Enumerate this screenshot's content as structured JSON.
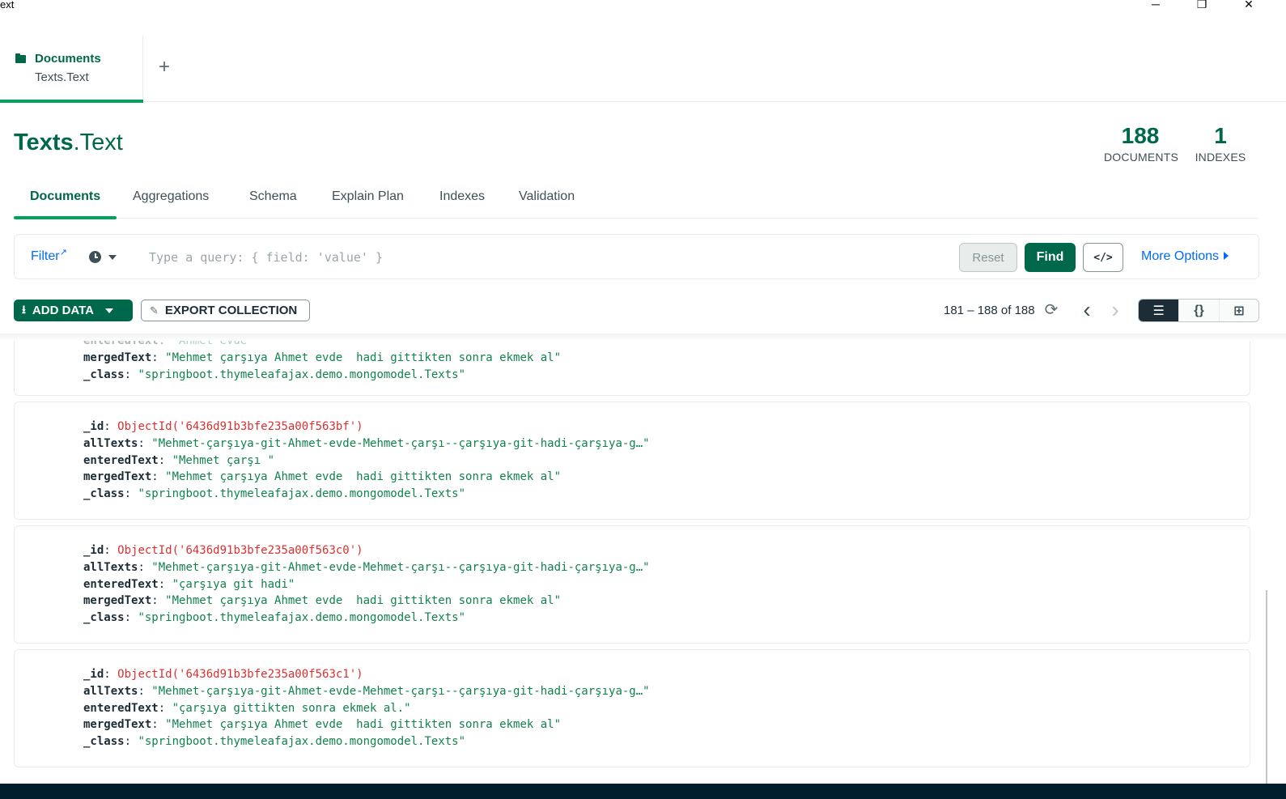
{
  "window": {
    "title": "ext",
    "minimize_glyph": "─",
    "restore_glyph": "❐",
    "close_glyph": "✕"
  },
  "workspace_tab": {
    "title": "Documents",
    "subtitle": "Texts.Text",
    "add_glyph": "+"
  },
  "collection": {
    "db": "Texts",
    "coll": ".Text"
  },
  "stats": [
    {
      "value": "188",
      "label": "DOCUMENTS"
    },
    {
      "value": "1",
      "label": "INDEXES"
    }
  ],
  "tabs": [
    {
      "label": "Documents",
      "active": true
    },
    {
      "label": "Aggregations"
    },
    {
      "label": "Schema"
    },
    {
      "label": "Explain Plan"
    },
    {
      "label": "Indexes"
    },
    {
      "label": "Validation"
    }
  ],
  "query_bar": {
    "filter_label": "Filter",
    "placeholder": "Type a query: { field: 'value' }",
    "reset_label": "Reset",
    "find_label": "Find",
    "code_glyph": "</>",
    "more_options_label": "More Options"
  },
  "toolbar": {
    "add_data_label": "ADD DATA",
    "export_label": "EXPORT COLLECTION",
    "pagination": "181 – 188 of 188",
    "refresh_glyph": "⟳",
    "prev_glyph": "‹",
    "next_glyph": "›",
    "view_list_glyph": "☰",
    "view_json_glyph": "{}",
    "view_table_glyph": "⊞"
  },
  "documents": [
    {
      "partial": true,
      "fields": [
        {
          "key": "enteredText",
          "type": "string",
          "value": "\"Ahmet evde\""
        },
        {
          "key": "mergedText",
          "type": "string",
          "value": "\"Mehmet çarşıya Ahmet evde  hadi gittikten sonra ekmek al\""
        },
        {
          "key": "_class",
          "type": "string",
          "value": "\"springboot.thymeleafajax.demo.mongomodel.Texts\""
        }
      ]
    },
    {
      "fields": [
        {
          "key": "_id",
          "type": "oid",
          "value": "ObjectId('6436d91b3bfe235a00f563bf')"
        },
        {
          "key": "allTexts",
          "type": "string",
          "value": "\"Mehmet-çarşıya-git-Ahmet-evde-Mehmet-çarşı--çarşıya-git-hadi-çarşıya-g…\""
        },
        {
          "key": "enteredText",
          "type": "string",
          "value": "\"Mehmet çarşı \""
        },
        {
          "key": "mergedText",
          "type": "string",
          "value": "\"Mehmet çarşıya Ahmet evde  hadi gittikten sonra ekmek al\""
        },
        {
          "key": "_class",
          "type": "string",
          "value": "\"springboot.thymeleafajax.demo.mongomodel.Texts\""
        }
      ]
    },
    {
      "fields": [
        {
          "key": "_id",
          "type": "oid",
          "value": "ObjectId('6436d91b3bfe235a00f563c0')"
        },
        {
          "key": "allTexts",
          "type": "string",
          "value": "\"Mehmet-çarşıya-git-Ahmet-evde-Mehmet-çarşı--çarşıya-git-hadi-çarşıya-g…\""
        },
        {
          "key": "enteredText",
          "type": "string",
          "value": "\"çarşıya git hadi\""
        },
        {
          "key": "mergedText",
          "type": "string",
          "value": "\"Mehmet çarşıya Ahmet evde  hadi gittikten sonra ekmek al\""
        },
        {
          "key": "_class",
          "type": "string",
          "value": "\"springboot.thymeleafajax.demo.mongomodel.Texts\""
        }
      ]
    },
    {
      "fields": [
        {
          "key": "_id",
          "type": "oid",
          "value": "ObjectId('6436d91b3bfe235a00f563c1')"
        },
        {
          "key": "allTexts",
          "type": "string",
          "value": "\"Mehmet-çarşıya-git-Ahmet-evde-Mehmet-çarşı--çarşıya-git-hadi-çarşıya-g…\""
        },
        {
          "key": "enteredText",
          "type": "string",
          "value": "\"çarşıya gittikten sonra ekmek al.\""
        },
        {
          "key": "mergedText",
          "type": "string",
          "value": "\"Mehmet çarşıya Ahmet evde  hadi gittikten sonra ekmek al\""
        },
        {
          "key": "_class",
          "type": "string",
          "value": "\"springboot.thymeleafajax.demo.mongomodel.Texts\""
        }
      ]
    }
  ]
}
